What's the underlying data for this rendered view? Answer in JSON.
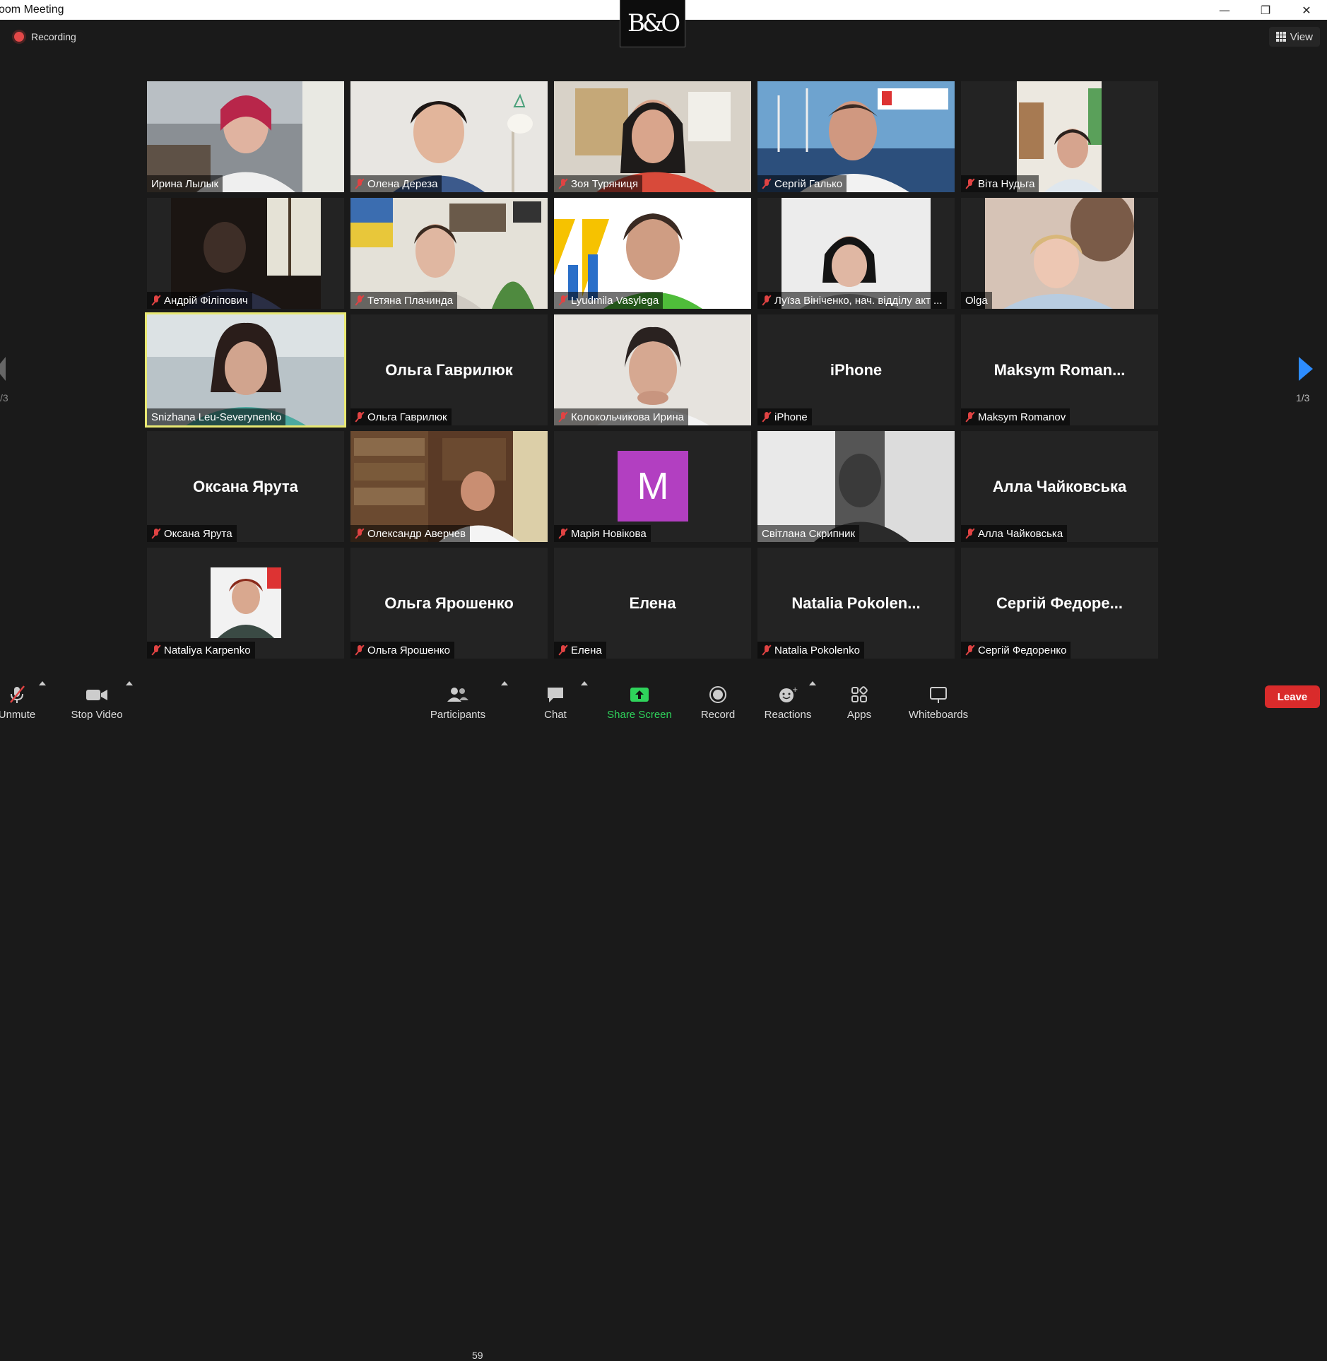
{
  "window": {
    "title": "oom Meeting",
    "minimize": "—",
    "restore": "❐",
    "close": "✕"
  },
  "logo": {
    "text": "B&O"
  },
  "recording": {
    "label": "Recording"
  },
  "view": {
    "label": "View"
  },
  "pagination": {
    "prev_label": "/3",
    "next_label": "1/3"
  },
  "tiles": [
    {
      "name": "Ирина Лылык",
      "muted": false
    },
    {
      "name": "Олена Дереза",
      "muted": true
    },
    {
      "name": "Зоя Туряниця",
      "muted": true
    },
    {
      "name": "Сергій Галько",
      "muted": true
    },
    {
      "name": "Віта Нудьга",
      "muted": true
    },
    {
      "name": "Андрій Філіпович",
      "muted": true
    },
    {
      "name": "Тетяна Плачинда",
      "muted": true
    },
    {
      "name": "Lyudmila Vasylega",
      "muted": true
    },
    {
      "name": "Луїза Вініченко, нач. відділу акт ...",
      "muted": true
    },
    {
      "name": "Olga",
      "muted": false
    },
    {
      "name": "Snizhana Leu-Severynenko",
      "muted": false
    },
    {
      "name": "Ольга Гаврилюк",
      "muted": true,
      "big": "Ольга Гаврилюк"
    },
    {
      "name": "Колокольчикова Ирина",
      "muted": true
    },
    {
      "name": "iPhone",
      "muted": true,
      "big": "iPhone"
    },
    {
      "name": "Maksym Romanov",
      "muted": true,
      "big": "Maksym  Roman..."
    },
    {
      "name": "Оксана Ярута",
      "muted": true,
      "big": "Оксана Ярута"
    },
    {
      "name": "Олександр Аверчев",
      "muted": true
    },
    {
      "name": "Марія Новікова",
      "muted": true,
      "avatar": "M"
    },
    {
      "name": "Світлана Скрипник",
      "muted": false
    },
    {
      "name": "Алла Чайковська",
      "muted": true,
      "big": "Алла Чайковська"
    },
    {
      "name": "Nataliya Karpenko",
      "muted": true
    },
    {
      "name": "Ольга Ярошенко",
      "muted": true,
      "big": "Ольга Ярошенко"
    },
    {
      "name": "Елена",
      "muted": true,
      "big": "Елена"
    },
    {
      "name": "Natalia Pokolenko",
      "muted": true,
      "big": "Natalia  Pokolen..."
    },
    {
      "name": "Сергій Федоренко",
      "muted": true,
      "big": "Сергій  Федоре..."
    }
  ],
  "toolbar": {
    "unmute": "Unmute",
    "stop_video": "Stop Video",
    "participants": "Participants",
    "participants_count": "59",
    "chat": "Chat",
    "share_screen": "Share Screen",
    "record": "Record",
    "reactions": "Reactions",
    "apps": "Apps",
    "whiteboards": "Whiteboards",
    "leave": "Leave"
  },
  "colors": {
    "accent": "#2d8cff",
    "share_green": "#2fd35b",
    "leave_red": "#d92b2b",
    "active_speaker": "#e8e873",
    "mute_red": "#e04343"
  }
}
